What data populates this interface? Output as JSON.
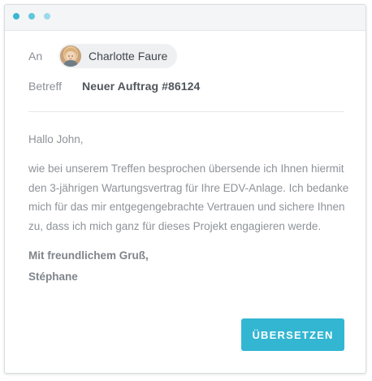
{
  "colors": {
    "accent": "#33b6d2",
    "dot_1": "#39b7d3",
    "dot_2": "#60c6dd",
    "dot_3": "#9adaea"
  },
  "email": {
    "to_label": "An",
    "recipient": {
      "name": "Charlotte Faure",
      "avatar_icon": "user-avatar-photo"
    },
    "subject_label": "Betreff",
    "subject": "Neuer Auftrag #86124",
    "greeting": "Hallo John,",
    "body": "wie bei unserem Treffen besprochen übersende ich Ihnen hiermit den 3-jährigen Wartungsvertrag für Ihre EDV-Anlage. Ich bedanke mich für das mir entgegengebrachte Vertrauen und sichere Ihnen zu, dass ich mich ganz für dieses Projekt engagieren werde.",
    "closing": "Mit freundlichem Gruß,",
    "sender": "Stéphane"
  },
  "actions": {
    "translate_label": "ÜBERSETZEN"
  }
}
